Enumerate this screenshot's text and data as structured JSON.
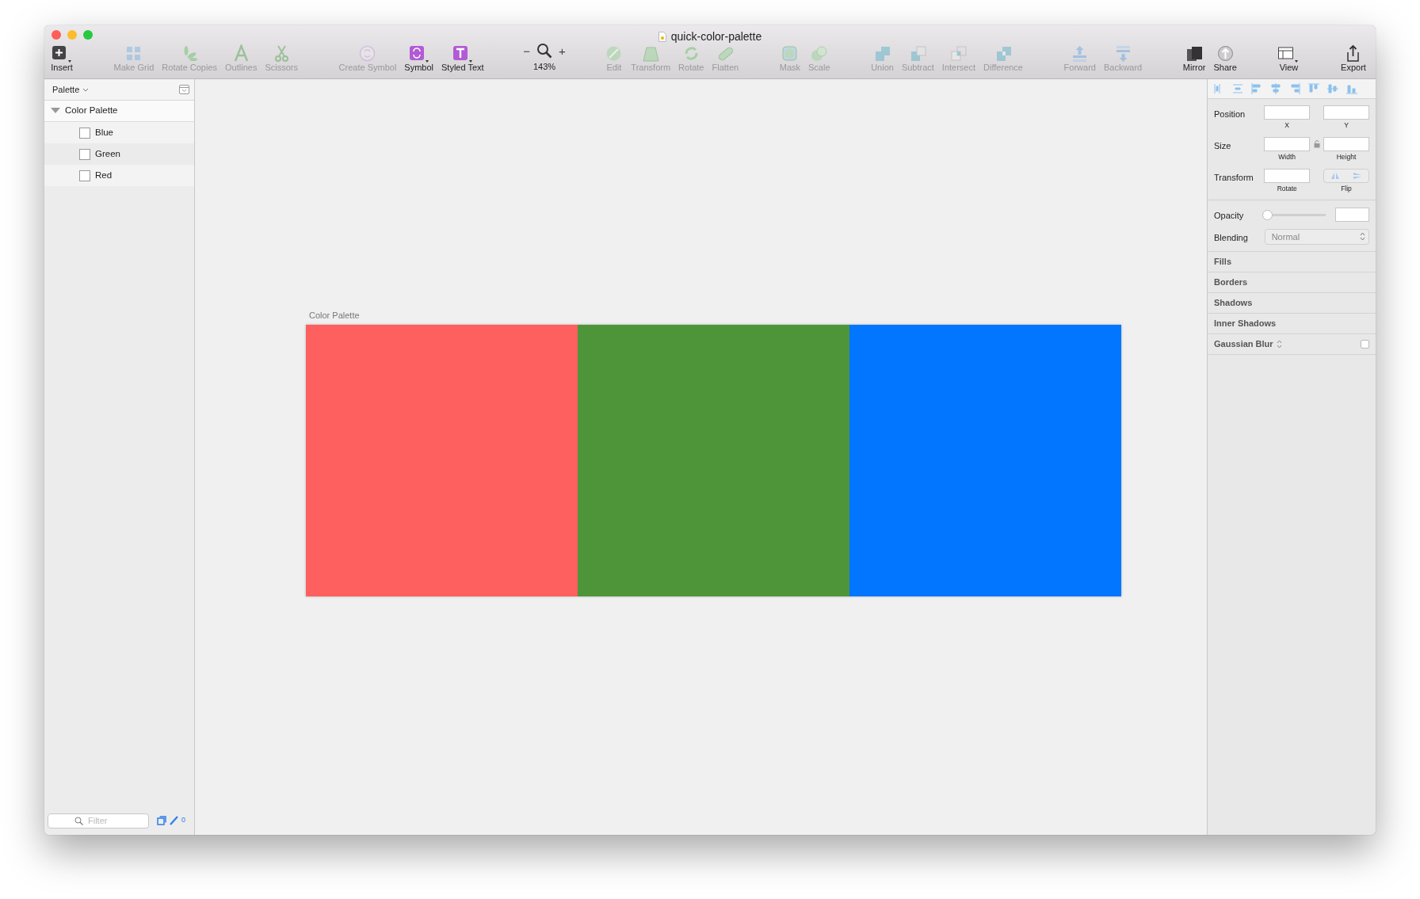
{
  "window": {
    "title": "quick-color-palette"
  },
  "toolbar_groups": [
    [
      {
        "kind": "tool",
        "label": "Insert",
        "disabled": false,
        "dropdown": true
      }
    ],
    [
      {
        "kind": "tool",
        "label": "Make Grid",
        "disabled": true,
        "dropdown": false
      },
      {
        "kind": "tool",
        "label": "Rotate Copies",
        "disabled": true,
        "dropdown": false
      },
      {
        "kind": "tool",
        "label": "Outlines",
        "disabled": true,
        "dropdown": false
      },
      {
        "kind": "tool",
        "label": "Scissors",
        "disabled": true,
        "dropdown": false
      }
    ],
    [
      {
        "kind": "tool",
        "label": "Create Symbol",
        "disabled": true,
        "dropdown": false
      },
      {
        "kind": "tool",
        "label": "Symbol",
        "disabled": false,
        "dropdown": true
      },
      {
        "kind": "tool",
        "label": "Styled Text",
        "disabled": false,
        "dropdown": true
      }
    ],
    [
      {
        "kind": "zoom",
        "zoom_out": "−",
        "zoom_in": "+",
        "value": "143%"
      }
    ],
    [
      {
        "kind": "tool",
        "label": "Edit",
        "disabled": true,
        "dropdown": false
      },
      {
        "kind": "tool",
        "label": "Transform",
        "disabled": true,
        "dropdown": false
      },
      {
        "kind": "tool",
        "label": "Rotate",
        "disabled": true,
        "dropdown": false
      },
      {
        "kind": "tool",
        "label": "Flatten",
        "disabled": true,
        "dropdown": false
      }
    ],
    [
      {
        "kind": "tool",
        "label": "Mask",
        "disabled": true,
        "dropdown": false
      },
      {
        "kind": "tool",
        "label": "Scale",
        "disabled": true,
        "dropdown": false
      }
    ],
    [
      {
        "kind": "tool",
        "label": "Union",
        "disabled": true,
        "dropdown": false
      },
      {
        "kind": "tool",
        "label": "Subtract",
        "disabled": true,
        "dropdown": false
      },
      {
        "kind": "tool",
        "label": "Intersect",
        "disabled": true,
        "dropdown": false
      },
      {
        "kind": "tool",
        "label": "Difference",
        "disabled": true,
        "dropdown": false
      }
    ],
    [
      {
        "kind": "tool",
        "label": "Forward",
        "disabled": true,
        "dropdown": false
      },
      {
        "kind": "tool",
        "label": "Backward",
        "disabled": true,
        "dropdown": false
      }
    ],
    [
      {
        "kind": "tool",
        "label": "Mirror",
        "disabled": false,
        "dropdown": false
      },
      {
        "kind": "tool",
        "label": "Share",
        "disabled": false,
        "dropdown": false
      }
    ],
    [
      {
        "kind": "tool",
        "label": "View",
        "disabled": false,
        "dropdown": true
      }
    ],
    [
      {
        "kind": "tool",
        "label": "Export",
        "disabled": false,
        "dropdown": false
      }
    ]
  ],
  "sidebar": {
    "header": "Palette",
    "layers": [
      {
        "name": "Color Palette",
        "expanded": true,
        "children": [
          {
            "name": "Blue"
          },
          {
            "name": "Green"
          },
          {
            "name": "Red"
          }
        ]
      }
    ],
    "filter_placeholder": "Filter",
    "footer_count": "0"
  },
  "canvas": {
    "artboard_title": "Color Palette",
    "swatches": [
      {
        "color": "#fe5f5f"
      },
      {
        "color": "#4e953a"
      },
      {
        "color": "#0276fe"
      }
    ]
  },
  "inspector": {
    "rows": [
      {
        "label": "Position",
        "linked": false,
        "controls": [
          {
            "kind": "input",
            "caption": "X"
          },
          {
            "kind": "input",
            "caption": "Y"
          }
        ]
      },
      {
        "label": "Size",
        "linked": true,
        "controls": [
          {
            "kind": "input",
            "caption": "Width"
          },
          {
            "kind": "input",
            "caption": "Height"
          }
        ]
      },
      {
        "label": "Transform",
        "linked": false,
        "controls": [
          {
            "kind": "input",
            "caption": "Rotate"
          },
          {
            "kind": "flip",
            "caption": "Flip"
          }
        ]
      }
    ],
    "opacity": {
      "label": "Opacity",
      "level": 0
    },
    "blending": {
      "label": "Blending",
      "value": "Normal"
    },
    "sections": [
      {
        "kind": "plain",
        "title": "Fills"
      },
      {
        "kind": "plain",
        "title": "Borders"
      },
      {
        "kind": "plain",
        "title": "Shadows"
      },
      {
        "kind": "plain",
        "title": "Inner Shadows"
      },
      {
        "kind": "toggle",
        "title": "Gaussian Blur",
        "checked": false
      }
    ]
  }
}
